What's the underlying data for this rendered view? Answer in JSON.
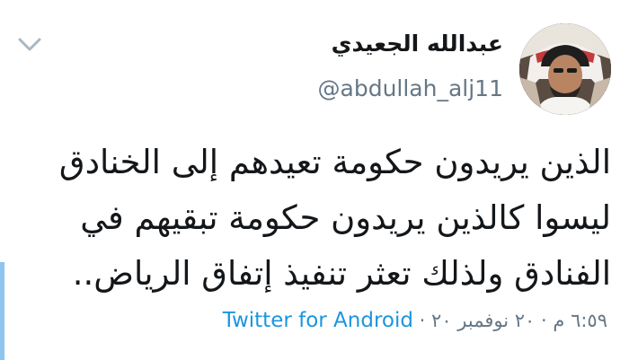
{
  "tweet": {
    "author": {
      "display_name": "عبدالله الجعيدي",
      "handle": "@abdullah_alj11"
    },
    "text": "الذين يريدون حكومة تعيدهم إلى الخنادق\nليسوا كالذين يريدون حكومة تبقيهم في\nالفنادق ولذلك تعثر تنفيذ إتفاق الرياض..",
    "time": "٦:٥٩ م",
    "separator_1": "·",
    "date": "٢٠ نوفمبر ٢٠",
    "separator_2": "·",
    "source": "Twitter for Android"
  },
  "icons": {
    "menu": "chevron-down-icon",
    "avatar": "user-avatar"
  },
  "colors": {
    "text": "#14171a",
    "secondary": "#657786",
    "link": "#1b95e0",
    "chevron": "#aab8c2",
    "accent_strip": "#8ec5ee"
  }
}
